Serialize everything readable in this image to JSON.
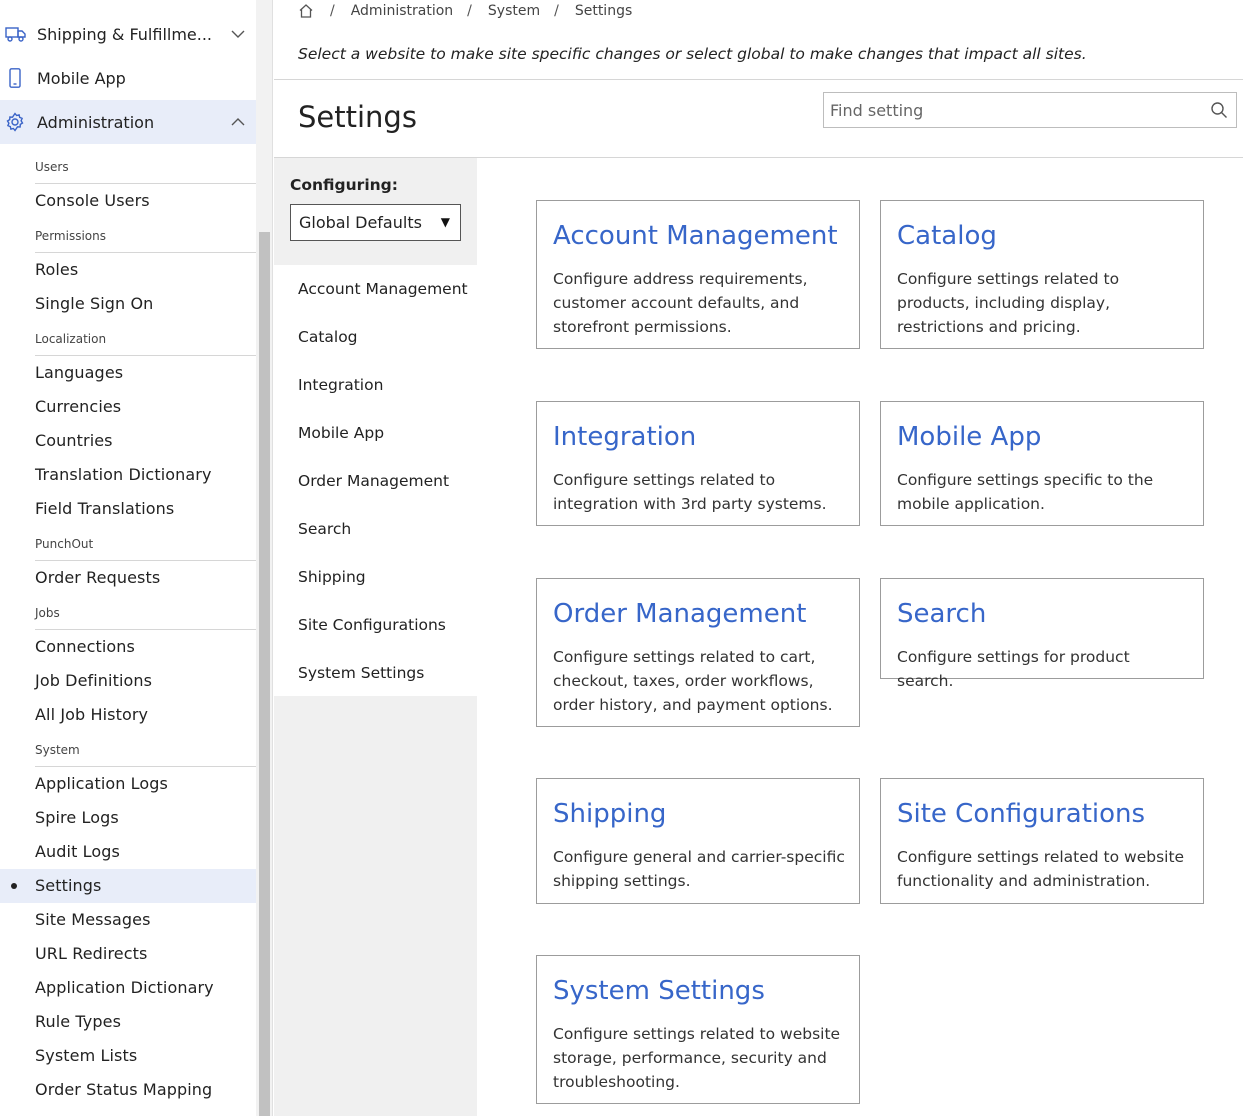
{
  "nav": {
    "top_items": [
      {
        "label": "Shipping & Fulfillme...",
        "icon": "truck-icon"
      },
      {
        "label": "Mobile App",
        "icon": "mobile-phone-icon"
      },
      {
        "label": "Administration",
        "icon": "gear-icon"
      }
    ],
    "groups": [
      {
        "label": "Users",
        "items": [
          "Console Users"
        ]
      },
      {
        "label": "Permissions",
        "items": [
          "Roles",
          "Single Sign On"
        ]
      },
      {
        "label": "Localization",
        "items": [
          "Languages",
          "Currencies",
          "Countries",
          "Translation Dictionary",
          "Field Translations"
        ]
      },
      {
        "label": "PunchOut",
        "items": [
          "Order Requests"
        ]
      },
      {
        "label": "Jobs",
        "items": [
          "Connections",
          "Job Definitions",
          "All Job History"
        ]
      },
      {
        "label": "System",
        "items": [
          "Application Logs",
          "Spire Logs",
          "Audit Logs",
          "Settings",
          "Site Messages",
          "URL Redirects",
          "Application Dictionary",
          "Rule Types",
          "System Lists",
          "Order Status Mapping"
        ]
      }
    ],
    "active_item": "Settings"
  },
  "breadcrumb": [
    "Administration",
    "System",
    "Settings"
  ],
  "intro_text": "Select a website to make site specific changes or select global to make changes that impact all sites.",
  "page_title": "Settings",
  "search": {
    "placeholder": "Find setting",
    "value": ""
  },
  "configuring": {
    "label": "Configuring:",
    "selected": "Global Defaults"
  },
  "subnav": [
    "Account Management",
    "Catalog",
    "Integration",
    "Mobile App",
    "Order Management",
    "Search",
    "Shipping",
    "Site Configurations",
    "System Settings"
  ],
  "cards": [
    {
      "title": "Account Management",
      "description": "Configure address requirements, customer account defaults, and storefront permissions."
    },
    {
      "title": "Catalog",
      "description": "Configure settings related to products, including display, restrictions and pricing."
    },
    {
      "title": "Integration",
      "description": "Configure settings related to integration with 3rd party systems."
    },
    {
      "title": "Mobile App",
      "description": "Configure settings specific to the mobile application."
    },
    {
      "title": "Order Management",
      "description": "Configure settings related to cart, checkout, taxes, order workflows, order history, and payment options."
    },
    {
      "title": "Search",
      "description": "Configure settings for product search."
    },
    {
      "title": "Shipping",
      "description": "Configure general and carrier-specific shipping settings."
    },
    {
      "title": "Site Configurations",
      "description": "Configure settings related to website functionality and administration."
    },
    {
      "title": "System Settings",
      "description": "Configure settings related to website storage, performance, security and troubleshooting."
    }
  ],
  "colors": {
    "accent": "#3766c9",
    "nav_active_bg": "#e8edf9",
    "subpanel_bg": "#f0f0f0"
  }
}
